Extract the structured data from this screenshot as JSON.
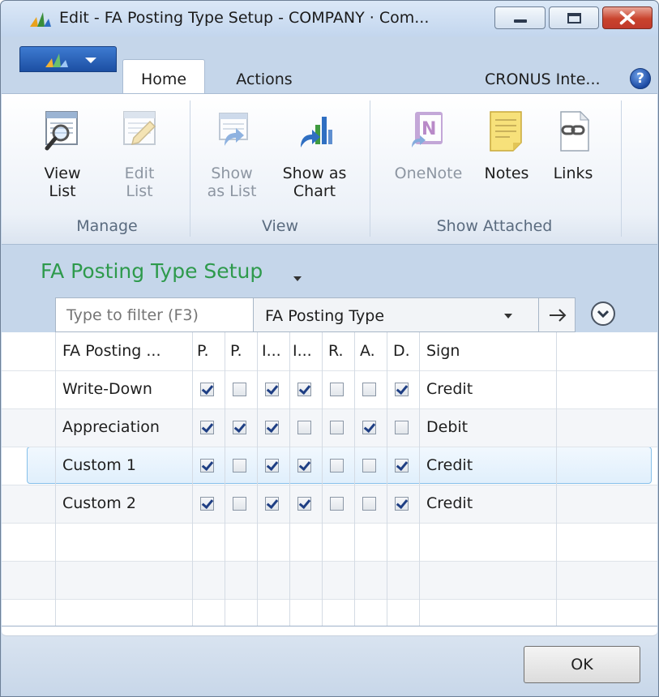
{
  "window": {
    "title": "Edit - FA Posting Type Setup - COMPANY · Com..."
  },
  "ribbon": {
    "tabs": [
      {
        "label": "Home",
        "active": true
      },
      {
        "label": "Actions",
        "active": false
      }
    ],
    "company": "CRONUS Inte...",
    "help_label": "?",
    "groups": [
      {
        "label": "Manage",
        "buttons": [
          {
            "label_1": "View",
            "label_2": "List",
            "icon": "view-list-icon",
            "enabled": true
          },
          {
            "label_1": "Edit",
            "label_2": "List",
            "icon": "edit-list-icon",
            "enabled": false
          }
        ]
      },
      {
        "label": "View",
        "buttons": [
          {
            "label_1": "Show",
            "label_2": "as List",
            "icon": "show-as-list-icon",
            "enabled": false
          },
          {
            "label_1": "Show as",
            "label_2": "Chart",
            "icon": "show-as-chart-icon",
            "enabled": true
          }
        ]
      },
      {
        "label": "Show Attached",
        "buttons": [
          {
            "label_1": "OneNote",
            "label_2": "",
            "icon": "onenote-icon",
            "enabled": false
          },
          {
            "label_1": "Notes",
            "label_2": "",
            "icon": "notes-icon",
            "enabled": true
          },
          {
            "label_1": "Links",
            "label_2": "",
            "icon": "links-icon",
            "enabled": true
          }
        ]
      }
    ]
  },
  "page": {
    "title": "FA Posting Type Setup"
  },
  "filter": {
    "placeholder": "Type to filter (F3)",
    "field": "FA Posting Type"
  },
  "grid": {
    "columns": [
      "FA Posting ...",
      "P.",
      "P.",
      "I...",
      "I...",
      "R.",
      "A.",
      "D.",
      "Sign"
    ],
    "rows": [
      {
        "name": "Write-Down",
        "checks": [
          true,
          false,
          true,
          true,
          false,
          false,
          true
        ],
        "sign": "Credit",
        "selected": false
      },
      {
        "name": "Appreciation",
        "checks": [
          true,
          true,
          true,
          false,
          false,
          true,
          false
        ],
        "sign": "Debit",
        "selected": false
      },
      {
        "name": "Custom 1",
        "checks": [
          true,
          false,
          true,
          true,
          false,
          false,
          true
        ],
        "sign": "Credit",
        "selected": true
      },
      {
        "name": "Custom 2",
        "checks": [
          true,
          false,
          true,
          true,
          false,
          false,
          true
        ],
        "sign": "Credit",
        "selected": false
      }
    ]
  },
  "footer": {
    "ok_label": "OK"
  },
  "colors": {
    "page_title": "#2e9a4c",
    "selection_border": "#86c0ea",
    "app_menu": "#1c4fa3"
  }
}
